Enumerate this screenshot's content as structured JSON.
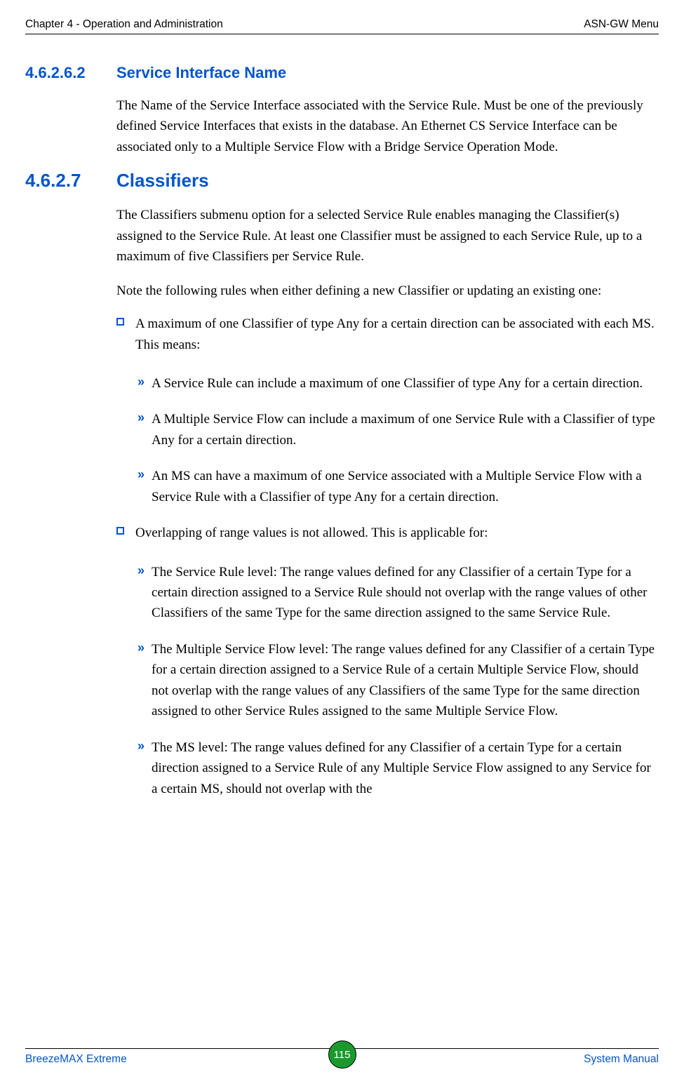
{
  "header": {
    "left": "Chapter 4 - Operation and Administration",
    "right": "ASN-GW Menu"
  },
  "sections": [
    {
      "number": "4.6.2.6.2",
      "title": "Service Interface Name",
      "size": "small",
      "paragraphs": [
        "The Name of the Service Interface associated with the Service Rule. Must be one of the previously defined Service Interfaces that exists in the database. An Ethernet CS Service Interface can be associated only to a Multiple Service Flow with a Bridge Service Operation Mode."
      ]
    },
    {
      "number": "4.6.2.7",
      "title": "Classifiers",
      "size": "big",
      "paragraphs": [
        "The Classifiers submenu option for a selected Service Rule enables managing the Classifier(s) assigned to the Service Rule. At least one Classifier must be assigned to each Service Rule, up to a maximum of five Classifiers per Service Rule.",
        "Note the following rules when either defining a new Classifier or updating an existing one:"
      ],
      "bullets": [
        {
          "text": "A maximum of one Classifier of type Any for a certain direction can be associated with each MS. This means:",
          "subs": [
            "A Service Rule can include a maximum of one Classifier of type Any for a certain direction.",
            "A Multiple Service Flow can include a maximum of one Service Rule with a Classifier of type Any for a certain direction.",
            "An MS can have a maximum of one Service associated with a Multiple Service Flow with a Service Rule with a Classifier of type Any for a certain direction."
          ]
        },
        {
          "text": "Overlapping of range values is not allowed. This is applicable for:",
          "subs": [
            "The Service Rule level: The range values defined for any Classifier of a certain Type for a certain direction assigned to a Service Rule should not overlap with the range values of other Classifiers of the same Type for the same direction assigned to the same Service Rule.",
            "The Multiple Service Flow level: The range values defined for any Classifier of a certain Type for a certain direction assigned to a Service Rule of a certain Multiple Service Flow, should not overlap with the range values of any Classifiers of the same Type for the same direction assigned to other Service Rules assigned to the same Multiple Service Flow.",
            "The MS level: The range values defined for any Classifier of a certain Type for a certain direction assigned to a Service Rule of any Multiple Service Flow assigned to any Service for a certain MS, should not overlap with the"
          ]
        }
      ]
    }
  ],
  "footer": {
    "left": "BreezeMAX Extreme",
    "page": "115",
    "right": "System Manual"
  }
}
